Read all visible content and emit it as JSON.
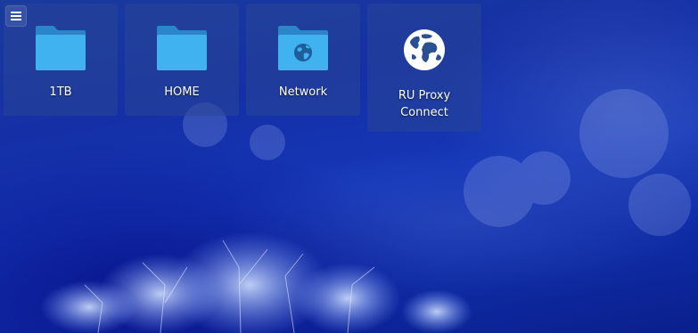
{
  "desktop": {
    "menu_button": {
      "icon": "hamburger-menu-icon"
    },
    "icons": [
      {
        "label_lines": [
          "1TB"
        ],
        "icon": "folder-icon",
        "color": "#3aa7e6"
      },
      {
        "label_lines": [
          "HOME"
        ],
        "icon": "folder-icon",
        "color": "#3aa7e6"
      },
      {
        "label_lines": [
          "Network"
        ],
        "icon": "network-folder-icon",
        "color": "#3aa7e6"
      },
      {
        "label_lines": [
          "RU Proxy",
          "Connect"
        ],
        "icon": "globe-icon",
        "color": "#ffffff"
      }
    ]
  },
  "colors": {
    "tile_background": "#28469680",
    "folder_front": "#3fb0ee",
    "folder_back": "#2a86c8"
  }
}
